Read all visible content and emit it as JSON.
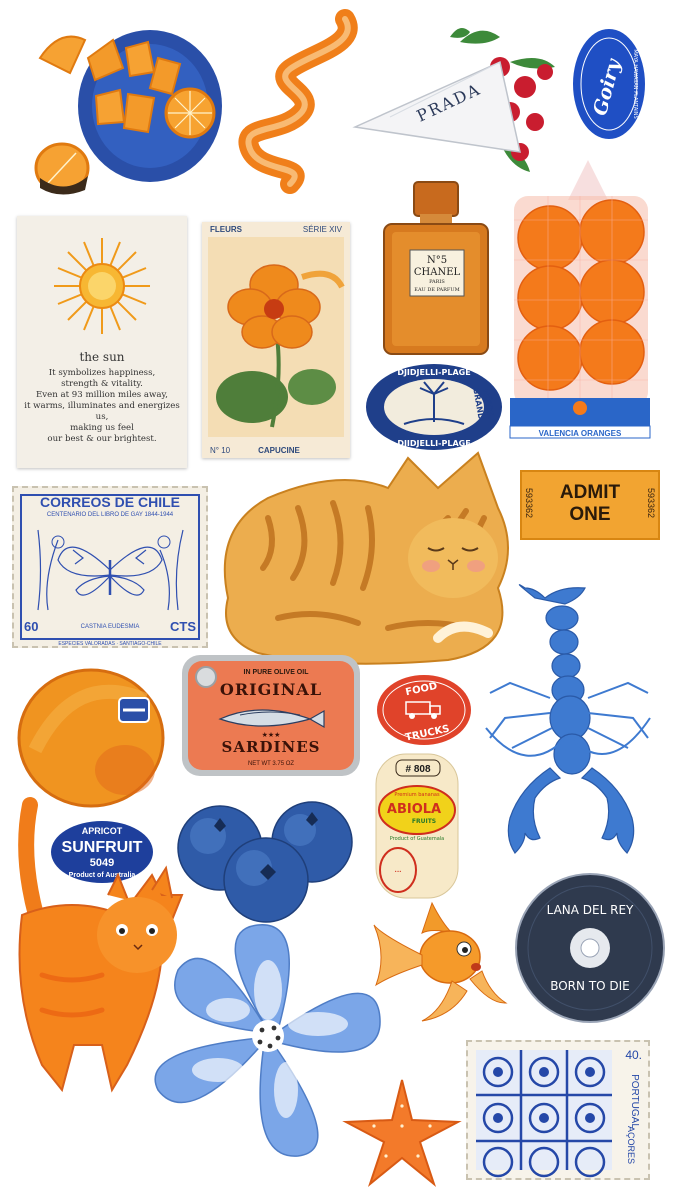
{
  "sun_card": {
    "title": "the sun",
    "lines": [
      "It symbolizes happiness,",
      "strength & vitality.",
      "Even at 93 million miles away,",
      "it warms, illuminates and energizes us,",
      "making us feel",
      "our best & our brightest."
    ]
  },
  "prada_label": "PRADA",
  "plantain_sticker": {
    "brand": "Goiry",
    "ring": "MAYA HAWAIIAN PLANTAINS"
  },
  "fleurs_card": {
    "header_left": "FLEURS",
    "header_right": "SÉRIE XIV",
    "footer_left": "N° 10",
    "footer_center": "CAPUCINE"
  },
  "chanel_bottle": {
    "line1": "N°5",
    "line2": "CHANEL",
    "line3": "PARIS",
    "line4": "EAU DE PARFUM"
  },
  "djidjelli_sticker": {
    "top": "DJIDJELLI-PLAGE",
    "bottom": "DJIDJELLI-PLAGE",
    "side1": "GRAND",
    "side2": "HÔTEL"
  },
  "valencia_label": "VALENCIA ORANGES",
  "chile_stamp": {
    "title": "CORREOS DE CHILE",
    "subtitle": "CENTENARIO DEL LIBRO DE GAY 1844-1944",
    "value_left": "60",
    "value_right": "CTS",
    "species": "CASTNIA EUDESMIA",
    "footer": "ESPECIES VALORADAS · SANTIAGO-CHILE"
  },
  "admit_ticket": {
    "line1": "ADMIT",
    "line2": "ONE",
    "serial": "593362"
  },
  "sardines_tin": {
    "top": "IN PURE OLIVE OIL",
    "word1": "ORIGINAL",
    "word2": "SARDINES",
    "stars": "★★★",
    "weight": "NET WT 3.75 OZ"
  },
  "food_trucks": {
    "top": "FOOD",
    "bottom": "TRUCKS"
  },
  "abiola_sticker": {
    "number": "# 808",
    "premium": "Premium bananas",
    "brand": "ABIOLA",
    "fruits": "FRUITS",
    "origin": "Product of Guatemala"
  },
  "sunfruit_sticker": {
    "top": "APRICOT",
    "brand": "SUNFRUIT",
    "code": "5049",
    "bottom": "Product of Australia"
  },
  "cd": {
    "artist": "LANA DEL REY",
    "album": "BORN TO DIE"
  },
  "portugal_stamp": {
    "value": "40.",
    "country": "PORTUGAL",
    "region": "AÇORES"
  },
  "colors": {
    "orange": "#f08a1e",
    "blue": "#2c55b8",
    "navy": "#1b3a8c",
    "red": "#d9412a"
  }
}
